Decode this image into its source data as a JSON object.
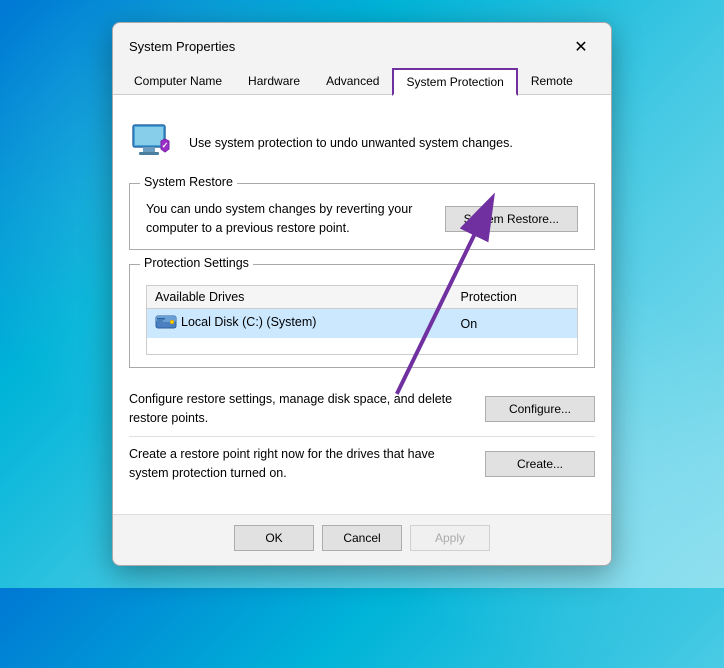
{
  "dialog": {
    "title": "System Properties",
    "close_label": "✕"
  },
  "tabs": [
    {
      "label": "Computer Name",
      "active": false
    },
    {
      "label": "Hardware",
      "active": false
    },
    {
      "label": "Advanced",
      "active": false
    },
    {
      "label": "System Protection",
      "active": true
    },
    {
      "label": "Remote",
      "active": false
    }
  ],
  "header": {
    "description": "Use system protection to undo unwanted system changes."
  },
  "system_restore": {
    "group_label": "System Restore",
    "description": "You can undo system changes by reverting your computer to a previous restore point.",
    "button_label": "System Restore..."
  },
  "protection_settings": {
    "group_label": "Protection Settings",
    "columns": [
      "Available Drives",
      "Protection"
    ],
    "drives": [
      {
        "name": "Local Disk (C:) (System)",
        "protection": "On"
      }
    ]
  },
  "actions": [
    {
      "description": "Configure restore settings, manage disk space, and delete restore points.",
      "button_label": "Configure..."
    },
    {
      "description": "Create a restore point right now for the drives that have system protection turned on.",
      "button_label": "Create..."
    }
  ],
  "footer": {
    "ok_label": "OK",
    "cancel_label": "Cancel",
    "apply_label": "Apply"
  },
  "icons": {
    "computer": "🖥",
    "drive": "💾"
  }
}
